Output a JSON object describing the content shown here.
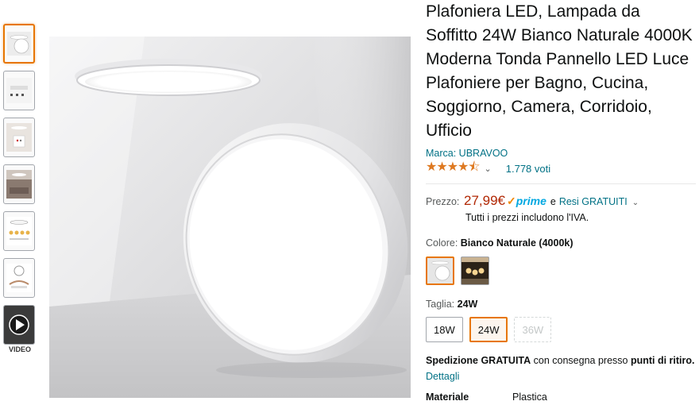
{
  "gallery": {
    "thumbnails": [
      {
        "kind": "image",
        "subject": "round-panel-hero"
      },
      {
        "kind": "image",
        "subject": "dimensions"
      },
      {
        "kind": "image",
        "subject": "bathroom-scene"
      },
      {
        "kind": "image",
        "subject": "room-scene"
      },
      {
        "kind": "image",
        "subject": "features"
      },
      {
        "kind": "image",
        "subject": "installation"
      },
      {
        "kind": "video",
        "subject": "product-video"
      }
    ],
    "video_label": "VIDEO",
    "selected_index": 0
  },
  "product": {
    "title": "Plafoniera LED, Lampada da Soffitto 24W Bianco Naturale 4000K Moderna Tonda Pannello LED Luce Plafoniere per Bagno, Cucina, Soggiorno, Camera, Corridoio, Ufficio",
    "brand": "Marca: UBRAVOO",
    "stars_glyph": "★★★★⯪",
    "rating_count": "1.778 voti",
    "price_label": "Prezzo:",
    "price": "27,99€",
    "prime_label": "prime",
    "and_text": "e",
    "returns_label": "Resi GRATUITI",
    "vat_note": "Tutti i prezzi includono l'IVA.",
    "color_label": "Colore:",
    "color_value": "Bianco Naturale (4000k)",
    "size_label": "Taglia:",
    "size_value": "24W",
    "sizes": [
      {
        "label": "18W",
        "state": "available"
      },
      {
        "label": "24W",
        "state": "selected"
      },
      {
        "label": "36W",
        "state": "unavailable"
      }
    ],
    "shipping_bold": "Spedizione GRATUITA",
    "shipping_text": " con consegna presso ",
    "shipping_bold2": "punti di ritiro.",
    "details_link": "Dettagli",
    "spec_key": "Materiale",
    "spec_value": "Plastica"
  },
  "colors": {
    "accent_selected": "#e77600",
    "price": "#b12704",
    "link": "#007185",
    "stars": "#de7921",
    "prime": "#00a8e1"
  }
}
